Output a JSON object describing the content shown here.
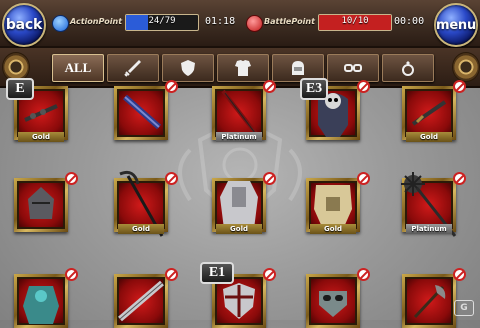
{
  "header": {
    "back_label": "back",
    "menu_label": "menu",
    "action_point": {
      "label": "ActionPoint",
      "value": "24/79",
      "current": 24,
      "max": 79,
      "timer": "01:18",
      "color": "#2b5cd8"
    },
    "battle_point": {
      "label": "BattlePoint",
      "value": "10/10",
      "current": 10,
      "max": 10,
      "timer": "00:00",
      "color": "#c42020"
    }
  },
  "tabs": [
    {
      "label": "ALL",
      "icon": "all-text",
      "active": true
    },
    {
      "label": "",
      "icon": "sword-icon"
    },
    {
      "label": "",
      "icon": "shield-icon"
    },
    {
      "label": "",
      "icon": "armor-icon"
    },
    {
      "label": "",
      "icon": "helmet-icon"
    },
    {
      "label": "",
      "icon": "goggles-icon"
    },
    {
      "label": "",
      "icon": "ring-icon"
    }
  ],
  "grid": {
    "rows": [
      [
        {
          "item": "chain-weapon",
          "tag": "Gold",
          "badge": "E"
        },
        {
          "item": "blue-sword",
          "tag": ""
        },
        {
          "item": "red-lance",
          "tag": "Platinum"
        },
        {
          "item": "skull-armor",
          "tag": "",
          "badge": "E3"
        },
        {
          "item": "rune-dagger",
          "tag": "Gold"
        }
      ],
      [
        {
          "item": "iron-helm",
          "tag": ""
        },
        {
          "item": "scythe",
          "tag": "Gold"
        },
        {
          "item": "knight-armor",
          "tag": "Gold"
        },
        {
          "item": "plate-armor",
          "tag": "Gold"
        },
        {
          "item": "spiked-mace",
          "tag": "Platinum"
        }
      ],
      [
        {
          "item": "teal-golem",
          "tag": ""
        },
        {
          "item": "great-blade",
          "tag": ""
        },
        {
          "item": "round-shield",
          "tag": "",
          "badge": "E1"
        },
        {
          "item": "plague-mask",
          "tag": ""
        },
        {
          "item": "axe",
          "tag": ""
        }
      ]
    ]
  },
  "watermark_text": "G"
}
